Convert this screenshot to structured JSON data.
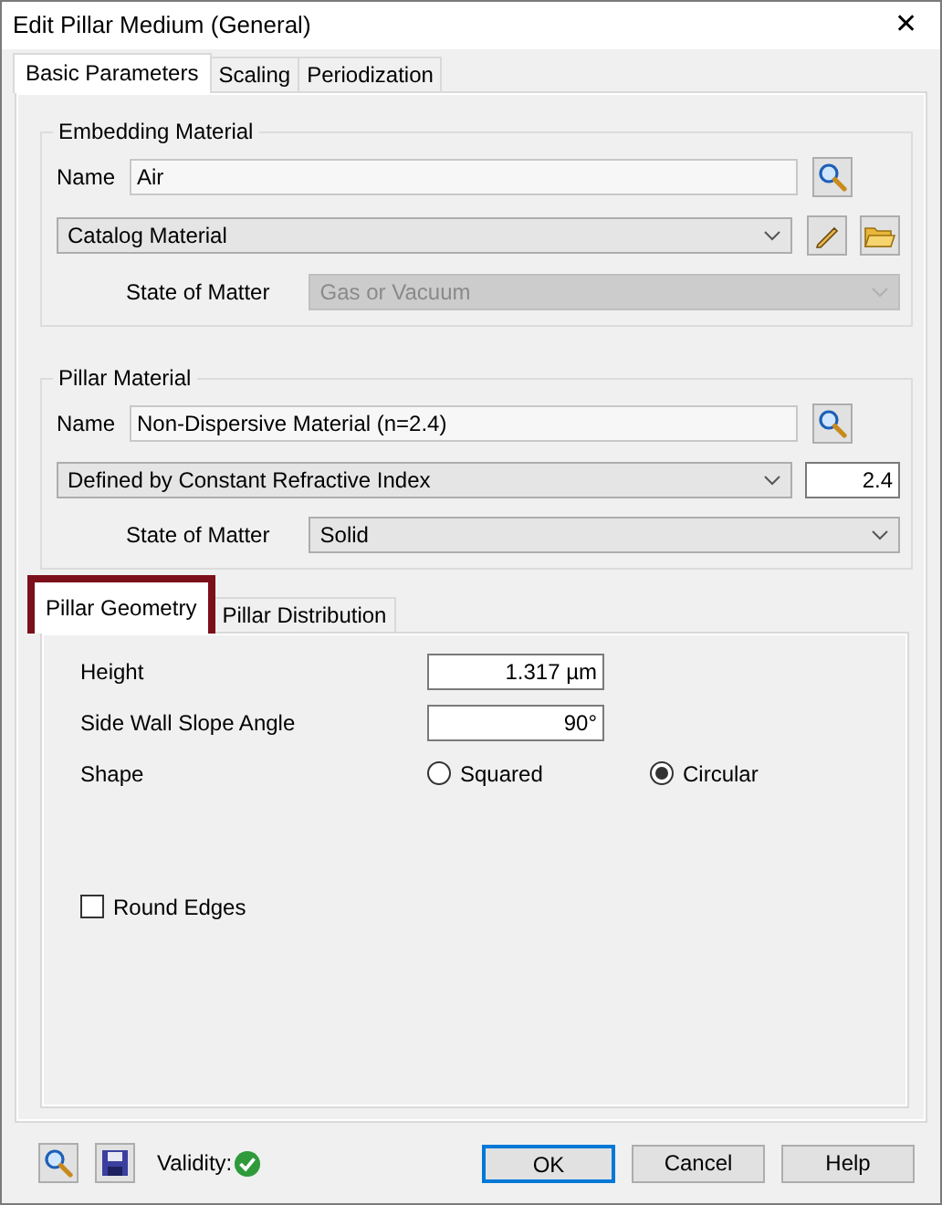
{
  "window": {
    "title": "Edit Pillar Medium (General)",
    "close": "✕"
  },
  "tabs": [
    {
      "label": "Basic Parameters",
      "selected": true
    },
    {
      "label": "Scaling",
      "selected": false
    },
    {
      "label": "Periodization",
      "selected": false
    }
  ],
  "embedding_material": {
    "title": "Embedding Material",
    "name_label": "Name",
    "name_value": "Air",
    "type": "Catalog Material",
    "state_label": "State of Matter",
    "state_value": "Gas or Vacuum",
    "state_disabled": true
  },
  "pillar_material": {
    "title": "Pillar Material",
    "name_label": "Name",
    "name_value": "Non-Dispersive Material (n=2.4)",
    "type": "Defined by Constant Refractive Index",
    "index_value": "2.4",
    "state_label": "State of Matter",
    "state_value": "Solid",
    "state_disabled": false
  },
  "inner_tabs": [
    {
      "label": "Pillar Geometry",
      "selected": true,
      "highlighted": true
    },
    {
      "label": "Pillar Distribution",
      "selected": false,
      "highlighted": false
    }
  ],
  "geometry": {
    "height_label": "Height",
    "height_value": "1.317 µm",
    "angle_label": "Side Wall Slope Angle",
    "angle_value": "90°",
    "shape_label": "Shape",
    "shape_options": [
      {
        "label": "Squared",
        "selected": false
      },
      {
        "label": "Circular",
        "selected": true
      }
    ],
    "round_edges": {
      "label": "Round Edges",
      "checked": false
    }
  },
  "footer": {
    "validity_label": "Validity:",
    "valid": true,
    "buttons": [
      {
        "label": "OK",
        "default": true
      },
      {
        "label": "Cancel",
        "default": false
      },
      {
        "label": "Help",
        "default": false
      }
    ]
  }
}
